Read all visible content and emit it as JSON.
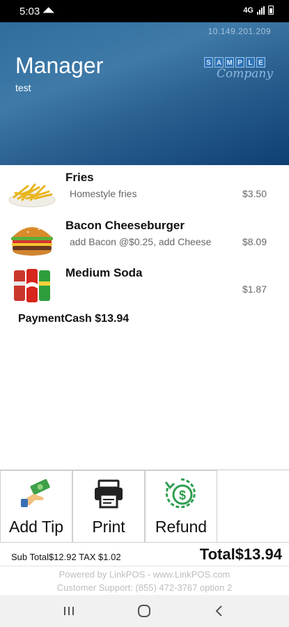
{
  "status_bar": {
    "time": "5:03",
    "network": "4G"
  },
  "header": {
    "ip_address": "10.149.201.209",
    "title": "Manager",
    "subtitle": "test",
    "logo": {
      "letters": [
        "S",
        "A",
        "M",
        "P",
        "L",
        "E"
      ],
      "script": "Company"
    }
  },
  "order": {
    "items": [
      {
        "name": "Fries",
        "description": "Homestyle fries",
        "price": "$3.50",
        "icon": "fries-icon"
      },
      {
        "name": "Bacon Cheeseburger",
        "description": "add Bacon @$0.25, add Cheese",
        "price": "$8.09",
        "icon": "burger-icon"
      },
      {
        "name": "Medium Soda",
        "description": "",
        "price": "$1.87",
        "icon": "soda-cans-icon"
      }
    ],
    "payment": "PaymentCash $13.94"
  },
  "actions": {
    "add_tip": {
      "label": "Add Tip",
      "icon": "hand-money-icon"
    },
    "print": {
      "label": "Print",
      "icon": "printer-icon"
    },
    "refund": {
      "label": "Refund",
      "icon": "refund-icon"
    }
  },
  "totals": {
    "sub_total_line": "Sub Total$12.92  TAX $1.02",
    "total": "Total$13.94"
  },
  "footer": {
    "powered_by": "Powered by LinkPOS - www.LinkPOS.com",
    "support": "Customer Support: (855) 472-3767 option 2"
  },
  "colors": {
    "header_start": "#3f7aa8",
    "header_end": "#0f3f74",
    "refund_green": "#2e9e4f",
    "tip_green": "#3fa04a"
  }
}
